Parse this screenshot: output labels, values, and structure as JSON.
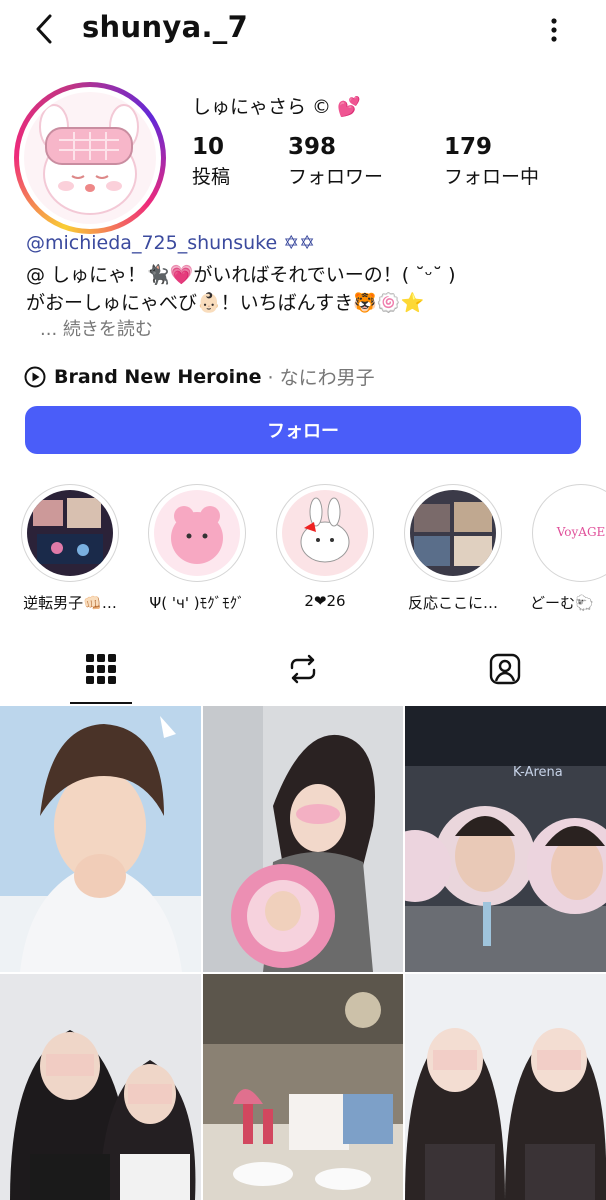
{
  "header": {
    "username": "shunya._7",
    "back_icon": "chevron-left-icon",
    "more_icon": "more-dots-icon"
  },
  "profile": {
    "display_name": "しゅにゃさら © 💕",
    "stats": [
      {
        "value": "10",
        "label": "投稿"
      },
      {
        "value": "398",
        "label": "フォロワー"
      },
      {
        "value": "179",
        "label": "フォロー中"
      }
    ],
    "bio": {
      "mention": "@michieda_725_shunsuke ✡✡",
      "line1": "@ しゅにゃ！🐈‍⬛💗がいればそれでいーの！( ˘ᵕ˘ )",
      "line2": "がおーしゅにゃべび👶🏻！いちばんすき🐯🍥⭐",
      "more": "... 続きを読む"
    },
    "music": {
      "title": "Brand New Heroine",
      "artist": "· なにわ男子"
    },
    "follow_label": "フォロー"
  },
  "highlights": [
    {
      "label": "逆転男子👊🏻…"
    },
    {
      "label": "Ψ( 'ч' )ﾓｸﾞﾓｸﾞ"
    },
    {
      "label": "2❤26"
    },
    {
      "label": "反応ここに…"
    },
    {
      "label": "どーむ🐑"
    }
  ],
  "tabs": [
    "grid-icon",
    "reels-repost-icon",
    "tagged-icon"
  ],
  "colors": {
    "follow_button": "#4a5df9",
    "link": "#3b4a9e"
  }
}
